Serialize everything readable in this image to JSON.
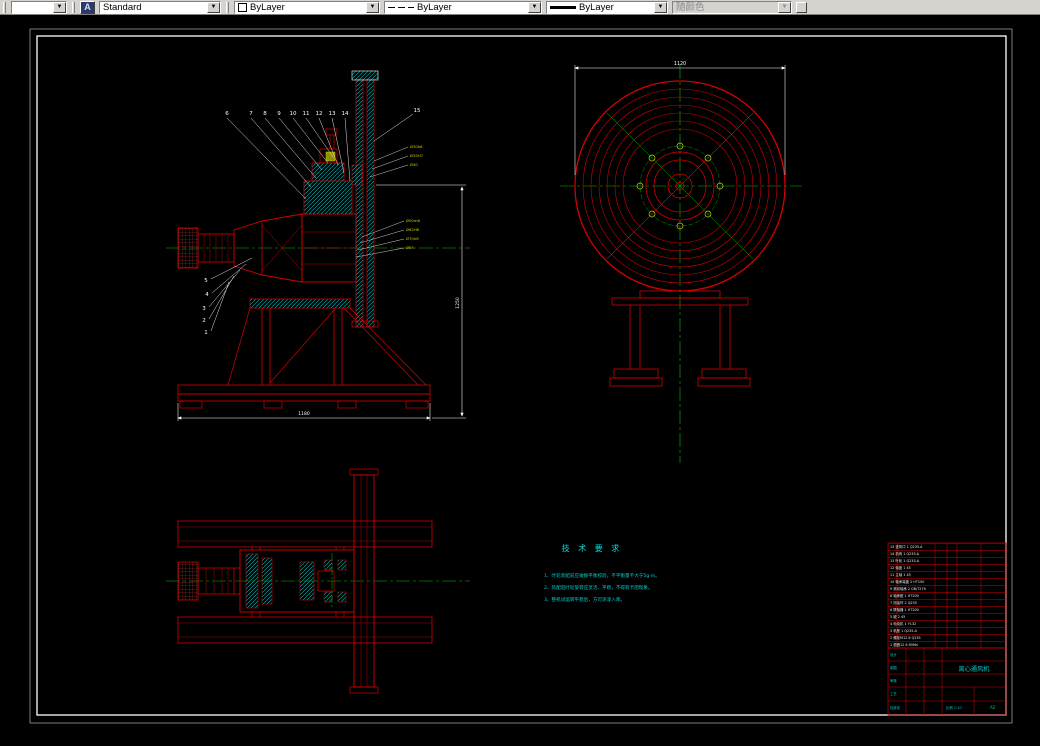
{
  "toolbar": {
    "style_value": "Standard",
    "color_value": "ByLayer",
    "linetype_value": "ByLayer",
    "lineweight_value": "ByLayer",
    "plotstyle_value": "随颜色"
  },
  "drawing": {
    "callouts": {
      "top": [
        "6",
        "7",
        "8",
        "9",
        "10",
        "11",
        "12",
        "13",
        "14"
      ],
      "top_right": "15",
      "left": [
        "5",
        "4",
        "3",
        "2",
        "1"
      ]
    },
    "dims": {
      "front_width": "1120",
      "side_base": "1180",
      "side_height": "1250",
      "fits_upper": [
        "Ø30k6",
        "Ø35H7",
        "Ø40"
      ],
      "fits_lower": [
        "Ø50m6",
        "Ø62H8",
        "Ø70h6",
        "Ø85"
      ]
    },
    "tech_requirements": {
      "title": "技 术 要 求",
      "items": [
        "1、叶轮装配前应做静平衡校验，不平衡量不大于5g·m。",
        "2、装配后叶轮旋转应灵活、平稳，不得有卡阻现象。",
        "3、整机试运转平稳后，方可涂漆入库。"
      ]
    },
    "parts_list": {
      "rows": [
        "15 进风口 1 Q235-A",
        "14 机壳 1 Q235-A",
        "13 叶轮 1 Q235-A",
        "12 轴盘 1 45",
        "11 主轴 1 45",
        "10 轴承端盖 2 HT150",
        "9 滚动轴承 2 GB/T276",
        "8 轴承座 1 HT200",
        "7 挡油环 2 Q235",
        "6 联轴器 1 HT200",
        "5 键 2 45",
        "4 电动机 1 Y132",
        "3 机座 1 Q235-A",
        "2 螺栓M12 8 Q235",
        "1 垫圈12 8 65Mn"
      ]
    },
    "title_block": {
      "fields": [
        "设计",
        "制图",
        "审核",
        "工艺",
        "标准化"
      ],
      "title": "离心通风机",
      "scale": "比例 1:10",
      "sheet": "A2"
    }
  }
}
